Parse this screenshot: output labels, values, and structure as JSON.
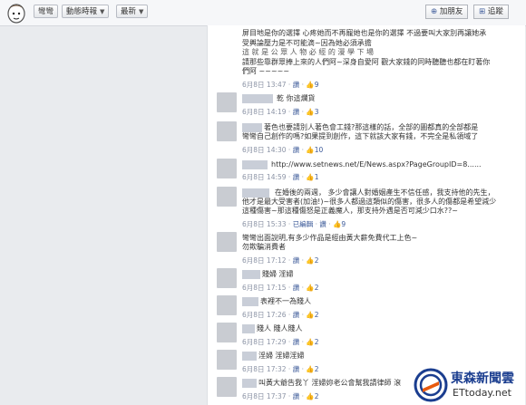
{
  "toolbar": {
    "wall_label": "彎彎",
    "timeline_label": "動態時報",
    "latest_label": "最新",
    "add_friend_label": "加朋友",
    "follow_label": "追蹤"
  },
  "feed": {
    "intro_lines": [
      "屏目地是你的選擇 心疼她而不再寵她也是你的選擇 不過要叫大家別再讓她承",
      "受輿論壓力是不可能滴~因為她必須承擔",
      "這 就 是 公 眾 人 物 必 經 的 漫 學 下 場",
      "請那些靠群眾捧上來的人們阿~深身自愛阿 觀大家錢的同時聽聽也都在盯著你",
      "們阿 ~~~~~"
    ],
    "intro_meta": {
      "date": "6月8日 13:47",
      "like": "讚",
      "count": "9"
    },
    "comments": [
      {
        "text": "乾 你這爛貨",
        "date": "6月8日 14:19",
        "like": "讚",
        "count": "3"
      },
      {
        "text": "著色也要請別人著色會工錢?那這樣的話，全部的圖都真的全部都是\n彎彎自己創作的嗎?如果提到創作，這下就該大家有錢，不完全是私領域了",
        "date": "6月8日 14:30",
        "like": "讚",
        "count": "10"
      },
      {
        "text": "http://www.setnews.net/E/News.aspx?PageGroupID=8......",
        "date": "6月8日 14:59",
        "like": "讚",
        "count": "1"
      },
      {
        "text": "在婚後的兩週， 多少會讓人對婚姻產生不信任感，我支持他的先生，\n他才是最大受害者(加油!)~很多人都過這類似的傷害，很多人的傷都是希望減少\n這種傷害~那這種傷怒是正義魔人，那支持外遇是否可減少口水??~",
        "date": "6月8日 15:33",
        "edit": "已編輯",
        "like": "讚",
        "count": "9"
      },
      {
        "text": "彎彎出面說明,有多少作品是經由黃大薪免費代工上色~\n勿欺騙消費者",
        "date": "6月8日 17:12",
        "like": "讚",
        "count": "2"
      },
      {
        "text": "賤婦 淫婦",
        "date": "6月8日 17:15",
        "like": "讚",
        "count": "2"
      },
      {
        "text": "表裡不一為賤人",
        "date": "6月8日 17:26",
        "like": "讚",
        "count": "2"
      },
      {
        "text": "賤人 賤人賤人",
        "date": "6月8日 17:29",
        "like": "讚",
        "count": "2"
      },
      {
        "text": "淫婦 淫婦淫婦",
        "date": "6月8日 17:32",
        "like": "讚",
        "count": "2"
      },
      {
        "text": "叫黃大爺告我丫 淫婦妳老公會幫我請律師 滾",
        "date": "6月8日 17:37",
        "like": "讚",
        "count": "2"
      }
    ]
  },
  "watermark": {
    "brand_cn": "東森新聞雲",
    "brand_en": "ETtoday.net",
    "brand_color": "#1a3d8f",
    "accent_color": "#e85a0e"
  }
}
